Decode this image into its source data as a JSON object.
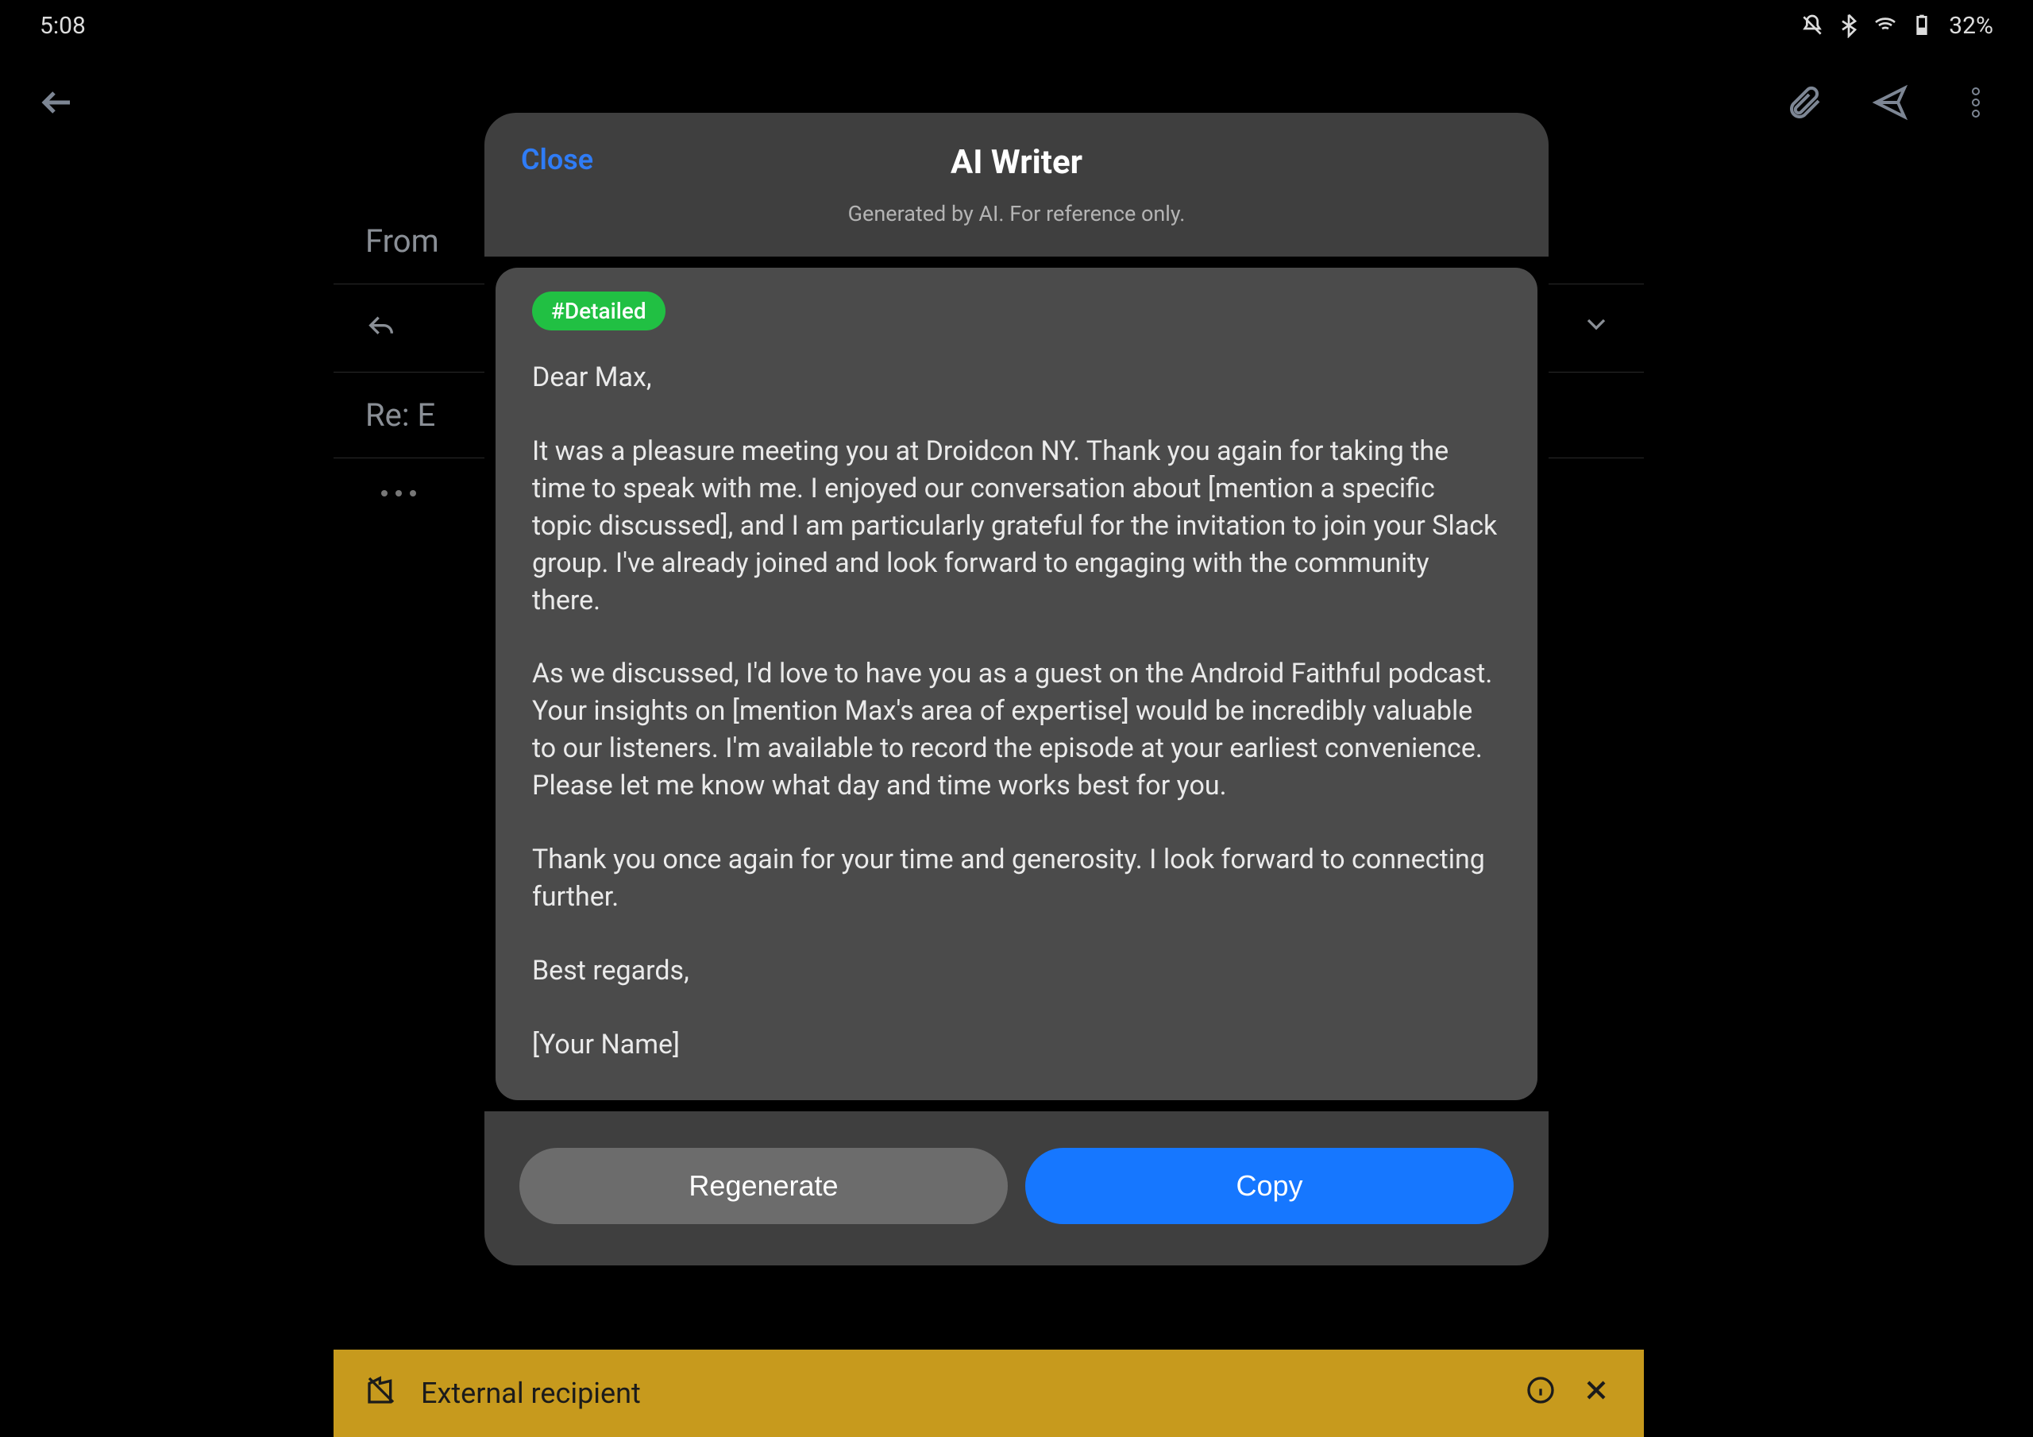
{
  "status_bar": {
    "time": "5:08",
    "battery_percent": "32%"
  },
  "app_icons": {
    "back": "back",
    "attach": "attach",
    "send": "send",
    "menu": "menu"
  },
  "compose": {
    "from_label": "From",
    "reply_prefix": "Re: E"
  },
  "ext_banner": {
    "text": "External recipient"
  },
  "modal": {
    "close": "Close",
    "title": "AI Writer",
    "subtitle": "Generated by AI. For reference only.",
    "tag": "#Detailed",
    "paragraphs": [
      "Dear Max,",
      "It was a pleasure meeting you at Droidcon NY. Thank you again for taking the time to speak with me. I enjoyed our conversation about [mention a specific topic discussed], and I am particularly grateful for the invitation to join your Slack group. I've already joined and look forward to engaging with the community there.",
      "As we discussed, I'd love to have you as a guest on the Android Faithful podcast. Your insights on [mention Max's area of expertise] would be incredibly valuable to our listeners. I'm available to record the episode at your earliest convenience. Please let me know what day and time works best for you.",
      "Thank you once again for your time and generosity. I look forward to connecting further.",
      "Best regards,",
      "[Your Name]"
    ],
    "regenerate": "Regenerate",
    "copy": "Copy"
  }
}
